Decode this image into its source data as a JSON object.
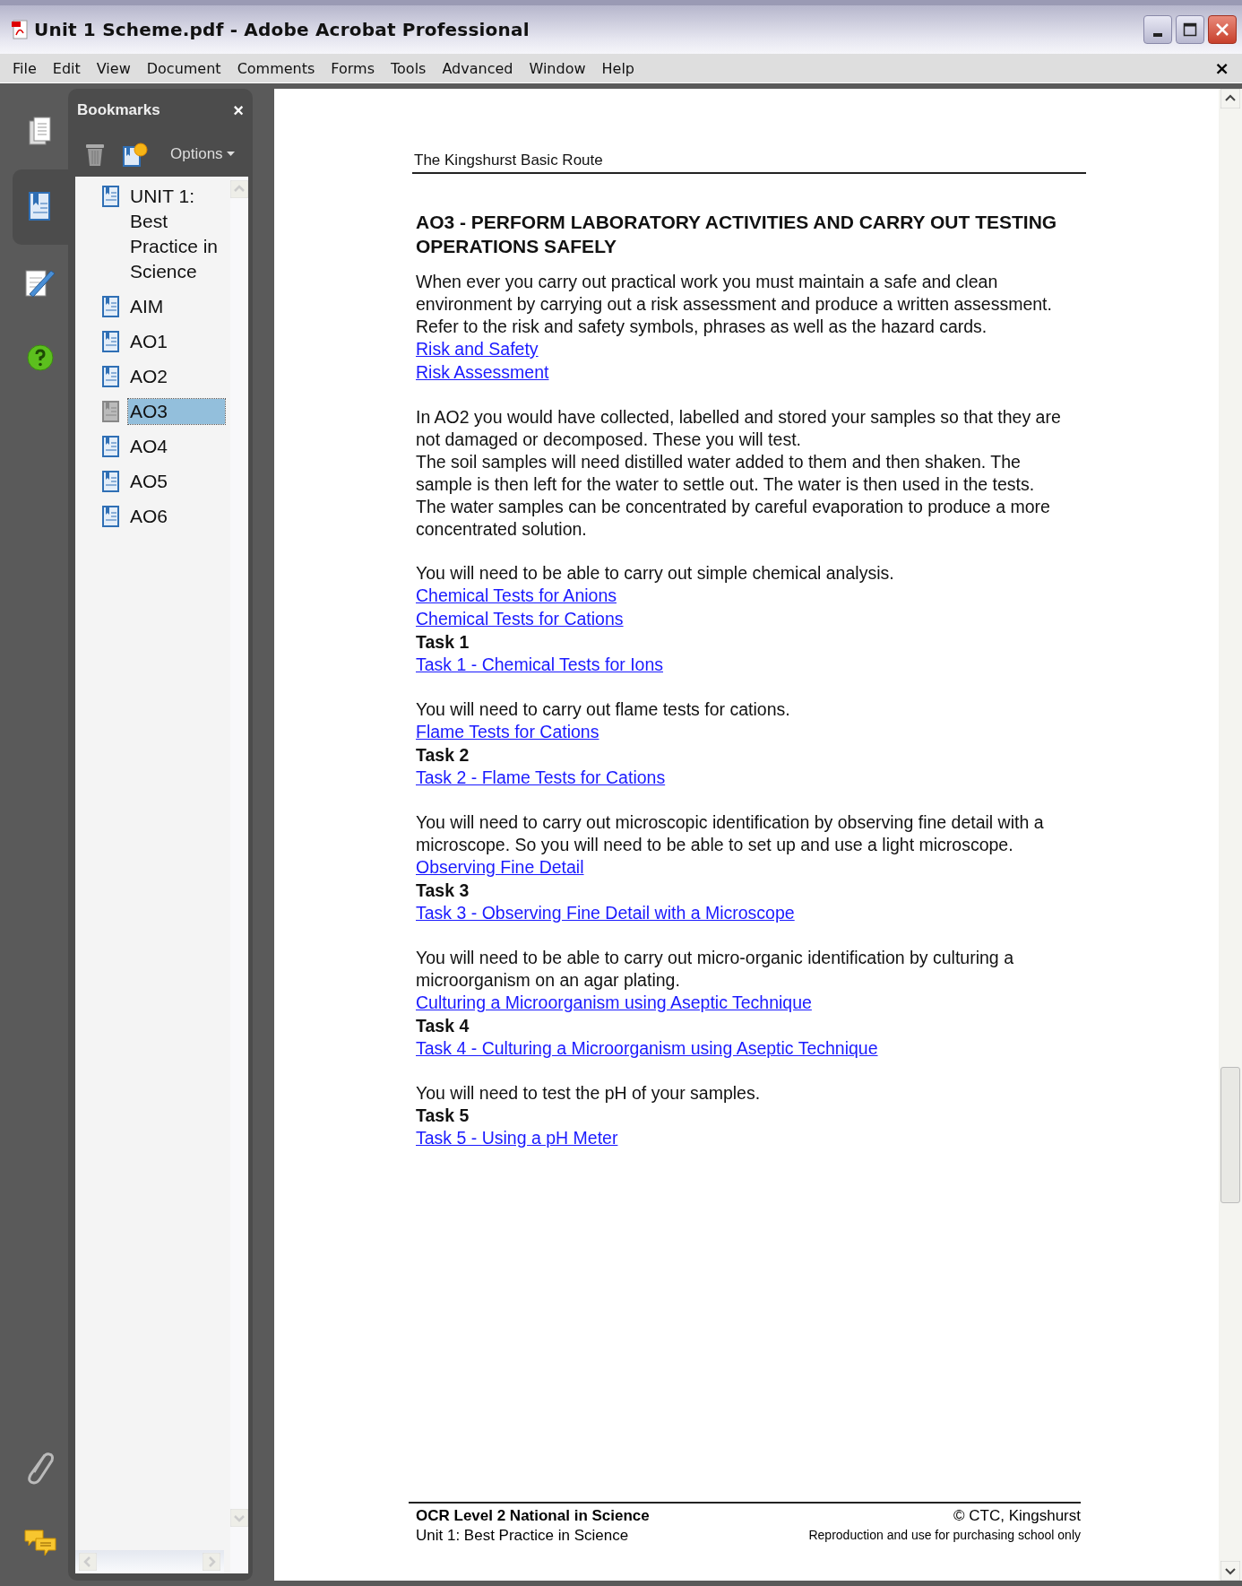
{
  "window": {
    "title": "Unit 1 Scheme.pdf - Adobe Acrobat Professional"
  },
  "menu": [
    "File",
    "Edit",
    "View",
    "Document",
    "Comments",
    "Forms",
    "Tools",
    "Advanced",
    "Window",
    "Help"
  ],
  "menu_close": "×",
  "bookmarks": {
    "title": "Bookmarks",
    "close": "×",
    "options": "Options",
    "items": [
      {
        "label": "UNIT 1: Best Practice in Science",
        "selected": false
      },
      {
        "label": "AIM",
        "selected": false
      },
      {
        "label": "AO1",
        "selected": false
      },
      {
        "label": "AO2",
        "selected": false
      },
      {
        "label": "AO3",
        "selected": true
      },
      {
        "label": "AO4",
        "selected": false
      },
      {
        "label": "AO5",
        "selected": false
      },
      {
        "label": "AO6",
        "selected": false
      }
    ]
  },
  "document": {
    "header": "The Kingshurst Basic Route",
    "heading": "AO3 - PERFORM LABORATORY ACTIVITIES AND CARRY OUT TESTING OPERATIONS SAFELY",
    "sections": [
      {
        "items": [
          {
            "kind": "para",
            "text": "When ever you carry out practical work you must maintain a safe and clean environment by carrying out a risk assessment and produce a written assessment. Refer to the risk and safety symbols, phrases as well as the hazard cards."
          },
          {
            "kind": "link",
            "text": "Risk and Safety"
          },
          {
            "kind": "link",
            "text": "Risk Assessment"
          }
        ]
      },
      {
        "items": [
          {
            "kind": "para",
            "text": "In AO2 you would have collected, labelled and stored your samples so that they are not damaged or decomposed. These you will test."
          },
          {
            "kind": "para",
            "text": "The soil samples will need distilled water added to them and then shaken. The sample is then left for the water to settle out. The water is then used in the tests."
          },
          {
            "kind": "para",
            "text": "The water samples can be concentrated by careful evaporation to produce a more concentrated solution."
          }
        ]
      },
      {
        "items": [
          {
            "kind": "para",
            "text": "You will need to be able to carry out simple chemical analysis."
          },
          {
            "kind": "link",
            "text": "Chemical Tests for Anions"
          },
          {
            "kind": "link",
            "text": "Chemical Tests for Cations"
          },
          {
            "kind": "task",
            "text": "Task 1"
          },
          {
            "kind": "link",
            "text": "Task 1 - Chemical Tests for Ions"
          }
        ]
      },
      {
        "items": [
          {
            "kind": "para",
            "text": "You will need to carry out flame tests for cations."
          },
          {
            "kind": "link",
            "text": "Flame Tests for Cations"
          },
          {
            "kind": "task",
            "text": "Task 2"
          },
          {
            "kind": "link",
            "text": "Task 2 - Flame Tests for Cations"
          }
        ]
      },
      {
        "items": [
          {
            "kind": "para",
            "text": "You will need to carry out microscopic identification by observing fine detail with a microscope. So you will need to be able to set up and use a light microscope."
          },
          {
            "kind": "link",
            "text": "Observing Fine Detail"
          },
          {
            "kind": "task",
            "text": "Task 3"
          },
          {
            "kind": "link",
            "text": "Task 3 - Observing Fine Detail with a Microscope"
          }
        ]
      },
      {
        "items": [
          {
            "kind": "para",
            "text": "You will need to be able to carry out micro-organic identification by culturing a microorganism on an agar plating."
          },
          {
            "kind": "link",
            "text": "Culturing a Microorganism using Aseptic Technique"
          },
          {
            "kind": "task",
            "text": "Task 4"
          },
          {
            "kind": "link",
            "text": "Task 4 - Culturing a Microorganism using Aseptic Technique"
          }
        ]
      },
      {
        "items": [
          {
            "kind": "para",
            "text": "You will need to test the pH of your samples."
          },
          {
            "kind": "task",
            "text": "Task 5"
          },
          {
            "kind": "link",
            "text": "Task 5 - Using a pH Meter"
          }
        ]
      }
    ],
    "footer": {
      "course": "OCR Level 2 National in Science",
      "unit": "Unit 1: Best Practice in Science",
      "copyright": "© CTC, Kingshurst",
      "notice": "Reproduction and use for purchasing school only"
    }
  }
}
